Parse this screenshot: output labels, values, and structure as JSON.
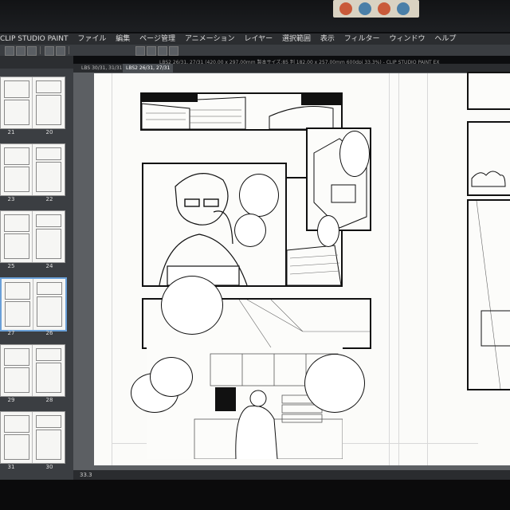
{
  "app": {
    "menu": [
      "CLIP STUDIO PAINT",
      "ファイル",
      "編集",
      "ページ管理",
      "アニメーション",
      "レイヤー",
      "選択範囲",
      "表示",
      "フィルター",
      "ウィンドウ",
      "ヘルプ"
    ]
  },
  "document": {
    "title": "LBS2 26/31, 27/31 (420.00 x 297.00mm 製本サイズ:85 判 182.00 x 257.00mm 600dpi 33.3%) - CLIP STUDIO PAINT EX",
    "tabs": [
      "LBS 30/31, 31/31",
      "LBS2 26/31, 27/31"
    ],
    "active_tab": 1
  },
  "pages_panel": {
    "pairs": [
      {
        "left": "21",
        "right": "20"
      },
      {
        "left": "23",
        "right": "22"
      },
      {
        "left": "25",
        "right": "24"
      },
      {
        "left": "27",
        "right": "26",
        "selected": true
      },
      {
        "left": "29",
        "right": "28"
      },
      {
        "left": "31",
        "right": "30"
      }
    ]
  },
  "status": {
    "zoom": "33.3"
  },
  "colors": {
    "accent": "#6aa0d8",
    "canvas_bg": "#5c5f63",
    "paper": "#fbfbf9",
    "ink": "#111111"
  }
}
